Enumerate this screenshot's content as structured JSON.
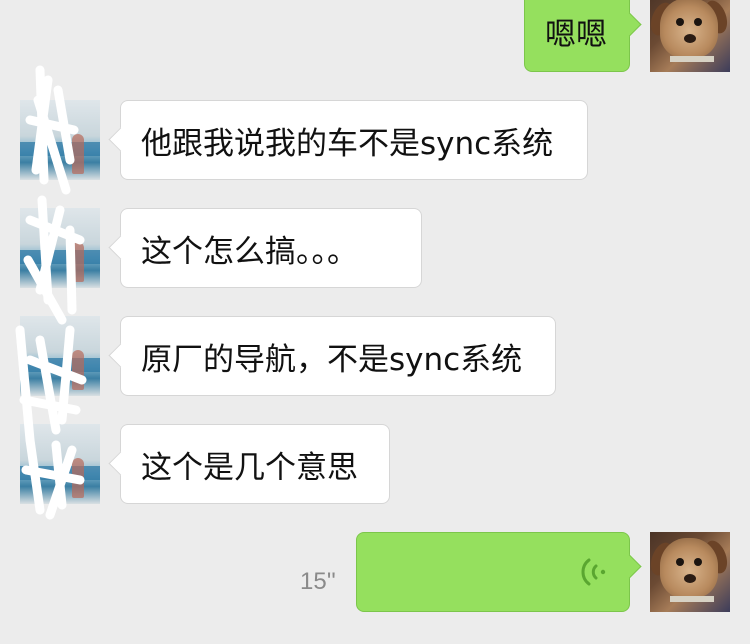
{
  "conversation": {
    "messages": [
      {
        "direction": "out",
        "type": "text",
        "text": "嗯嗯"
      },
      {
        "direction": "in",
        "type": "text",
        "text": "他跟我说我的车不是sync系统"
      },
      {
        "direction": "in",
        "type": "text",
        "text": "这个怎么搞。。。"
      },
      {
        "direction": "in",
        "type": "text",
        "text": "原厂的导航，不是sync系统"
      },
      {
        "direction": "in",
        "type": "text",
        "text": "这个是几个意思"
      },
      {
        "direction": "out",
        "type": "voice",
        "duration": "15''"
      }
    ]
  },
  "icons": {
    "voice": "voice-wave-icon",
    "self_avatar": "puppy-avatar",
    "other_avatar": "beach-photo-avatar"
  },
  "colors": {
    "background": "#ececec",
    "outgoing_bubble": "#95e05e",
    "incoming_bubble": "#ffffff",
    "duration_text": "#8a8a8a"
  }
}
